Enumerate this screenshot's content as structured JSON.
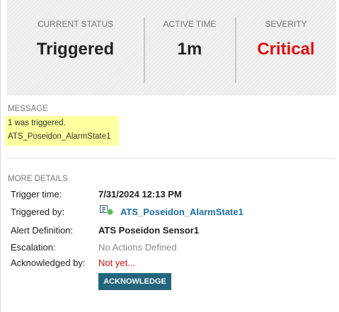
{
  "status": {
    "current_status_label": "CURRENT STATUS",
    "current_status_value": "Triggered",
    "active_time_label": "ACTIVE TIME",
    "active_time_value": "1m",
    "severity_label": "SEVERITY",
    "severity_value": "Critical"
  },
  "message": {
    "label": "MESSAGE",
    "lines": [
      "1 was triggered.",
      "ATS_Poseidon_AlarmState1"
    ]
  },
  "details": {
    "label": "MORE DETAILS",
    "trigger_time_label": "Trigger time:",
    "trigger_time_value": "7/31/2024 12:13 PM",
    "triggered_by_label": "Triggered by:",
    "triggered_by_value": "ATS_Poseidon_AlarmState1",
    "triggered_by_icon": "sensor-status-icon",
    "alert_definition_label": "Alert Definition:",
    "alert_definition_value": "ATS Poseidon Sensor1",
    "escalation_label": "Escalation:",
    "escalation_value": "No Actions Defined",
    "acknowledged_by_label": "Acknowledged by:",
    "acknowledged_by_value": "Not yet..."
  },
  "actions": {
    "acknowledge_label": "ACKNOWLEDGE"
  },
  "colors": {
    "critical": "#e20d0d",
    "link": "#1c6ea4",
    "button_bg": "#23667c",
    "message_highlight": "#ffff9e",
    "status_ok_dot": "#5cb85c"
  }
}
